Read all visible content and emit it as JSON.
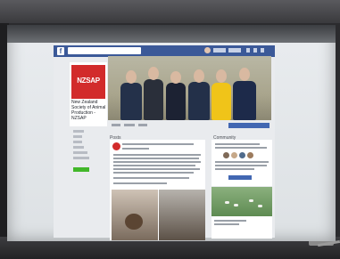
{
  "scene": {
    "description_colors": {
      "screen": "#e9ecef",
      "fb_blue": "#3b5998",
      "logo_red": "#d22b2b",
      "like_green": "#42b72a"
    }
  },
  "browser": {
    "fb_logo": "f"
  },
  "page": {
    "logo_text": "NZSAP",
    "name": "New Zealand Society of Animal Production - NZSAP",
    "posts_label": "Posts",
    "about_label": "Community"
  }
}
